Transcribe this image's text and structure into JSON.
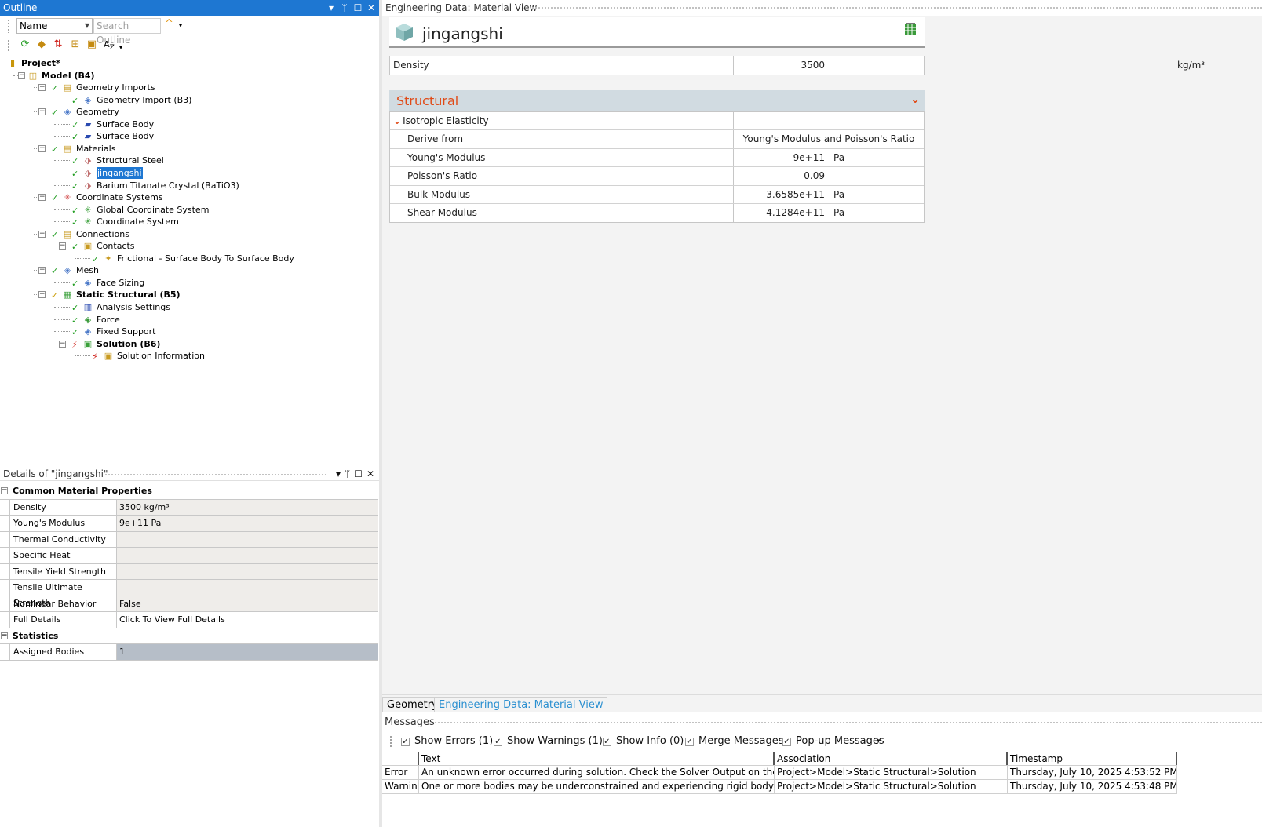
{
  "outline": {
    "title": "Outline",
    "name_filter": "Name",
    "search_placeholder": "Search Outline",
    "tree": [
      {
        "label": "Project*",
        "bold": true
      },
      {
        "label": "Model (B4)",
        "bold": true
      },
      {
        "label": "Geometry Imports"
      },
      {
        "label": "Geometry Import (B3)"
      },
      {
        "label": "Geometry"
      },
      {
        "label": "Surface Body"
      },
      {
        "label": "Surface Body"
      },
      {
        "label": "Materials"
      },
      {
        "label": "Structural Steel"
      },
      {
        "label": "jingangshi",
        "selected": true
      },
      {
        "label": "Barium Titanate Crystal (BaTiO3)"
      },
      {
        "label": "Coordinate Systems"
      },
      {
        "label": "Global Coordinate System"
      },
      {
        "label": "Coordinate System"
      },
      {
        "label": "Connections"
      },
      {
        "label": "Contacts"
      },
      {
        "label": "Frictional - Surface Body To Surface Body"
      },
      {
        "label": "Mesh"
      },
      {
        "label": "Face Sizing"
      },
      {
        "label": "Static Structural (B5)",
        "bold": true
      },
      {
        "label": "Analysis Settings"
      },
      {
        "label": "Force"
      },
      {
        "label": "Fixed Support"
      },
      {
        "label": "Solution (B6)",
        "bold": true
      },
      {
        "label": "Solution Information"
      }
    ]
  },
  "details": {
    "title": "Details of \"jingangshi\"",
    "rows": [
      {
        "label": "Common Material Properties",
        "section": true
      },
      {
        "label": "Density",
        "value": "3500 kg/m³"
      },
      {
        "label": "Young's Modulus",
        "value": "9e+11 Pa"
      },
      {
        "label": "Thermal Conductivity",
        "value": ""
      },
      {
        "label": "Specific Heat",
        "value": ""
      },
      {
        "label": "Tensile Yield Strength",
        "value": ""
      },
      {
        "label": "Tensile Ultimate Strength",
        "value": ""
      },
      {
        "label": "Nonlinear Behavior",
        "value": "False"
      },
      {
        "label": "Full Details",
        "value": "Click To View Full Details"
      },
      {
        "label": "Statistics",
        "section": true
      },
      {
        "label": "Assigned Bodies",
        "value": "1"
      }
    ]
  },
  "engineering": {
    "title": "Engineering Data: Material View",
    "material_name": "jingangshi",
    "density": {
      "label": "Density",
      "value": "3500",
      "unit": "kg/m³"
    },
    "section_title": "Structural",
    "props": [
      {
        "label": "Isotropic Elasticity",
        "value": "",
        "unit": "",
        "group": true
      },
      {
        "label": "Derive from",
        "value": "Young's Modulus and Poisson's Ratio",
        "unit": "",
        "centered": true
      },
      {
        "label": "Young's Modulus",
        "value": "9e+11",
        "unit": "Pa"
      },
      {
        "label": "Poisson's Ratio",
        "value": "0.09",
        "unit": ""
      },
      {
        "label": "Bulk Modulus",
        "value": "3.6585e+11",
        "unit": "Pa"
      },
      {
        "label": "Shear Modulus",
        "value": "4.1284e+11",
        "unit": "Pa"
      }
    ]
  },
  "tabs": [
    "Geometry",
    "Engineering Data: Material View"
  ],
  "messages": {
    "title": "Messages",
    "filters": [
      {
        "label": "Show Errors",
        "count": "(1)"
      },
      {
        "label": "Show Warnings",
        "count": "(1)"
      },
      {
        "label": "Show Info",
        "count": "(0)"
      },
      {
        "label": "Merge Messages",
        "count": ""
      },
      {
        "label": "Pop-up Messages",
        "count": ""
      }
    ],
    "columns": [
      "",
      "Text",
      "Association",
      "Timestamp"
    ],
    "rows": [
      {
        "type": "Error",
        "text": "An unknown error occurred during solution.  Check the Solver Output on the Solution Information object for possible causes.",
        "association": "Project>Model>Static Structural>Solution",
        "timestamp": "Thursday, July 10, 2025 4:53:52 PM"
      },
      {
        "type": "Warning",
        "text": "One or more bodies may be underconstrained and experiencing rigid body motion. Weak springs have been added.",
        "association": "Project>Model>Static Structural>Solution",
        "timestamp": "Thursday, July 10, 2025 4:53:48 PM"
      }
    ]
  },
  "colors": {
    "accent": "#1e77d2",
    "section": "#e04a17"
  }
}
